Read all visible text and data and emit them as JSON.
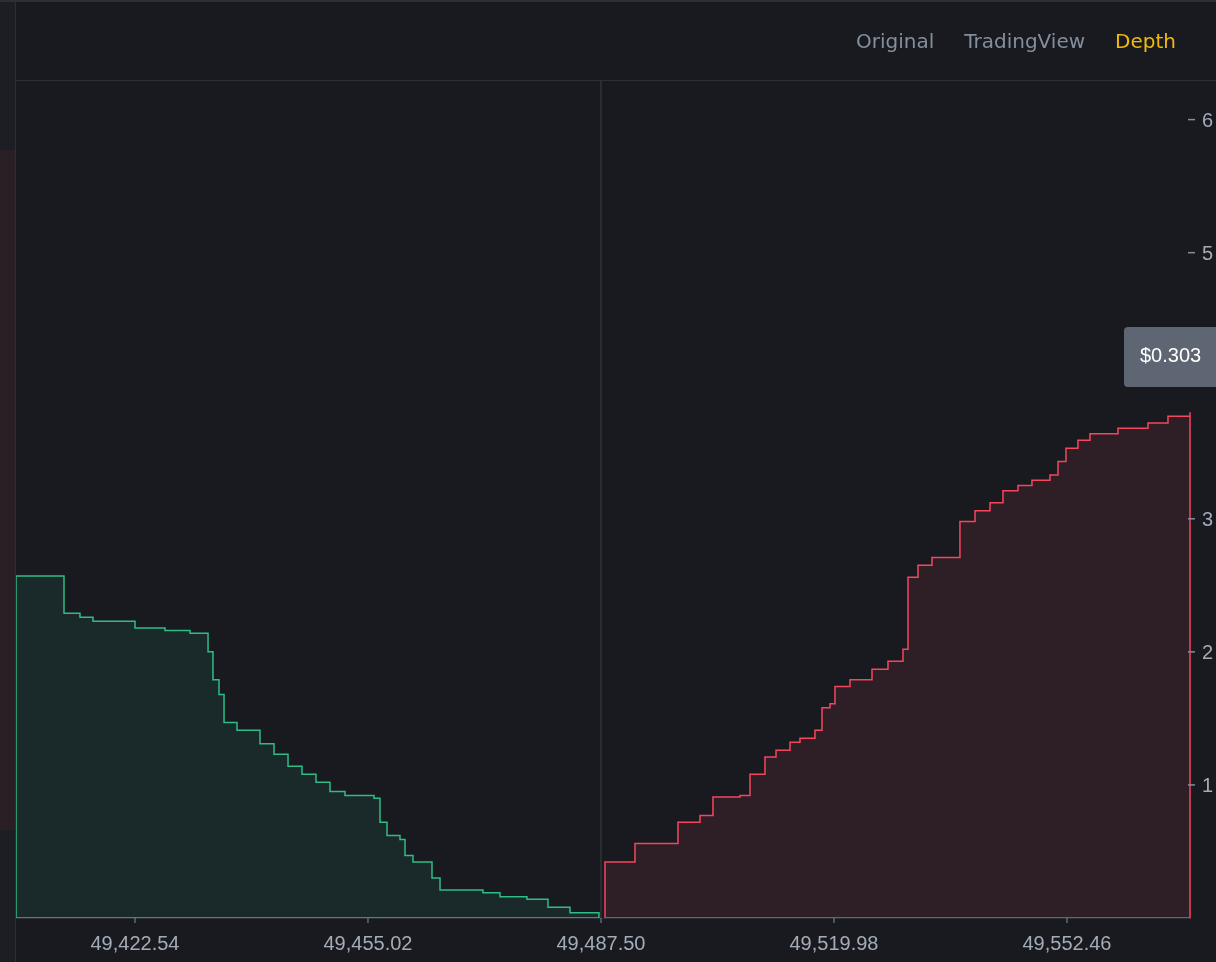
{
  "tabs": [
    {
      "label": "Original",
      "selected": false
    },
    {
      "label": "TradingView",
      "selected": false
    },
    {
      "label": "Depth",
      "selected": true
    }
  ],
  "tooltip": {
    "value": "$0.303"
  },
  "chart_data": {
    "type": "area",
    "x": [
      49405.95,
      49412.64,
      49414.87,
      49416.68,
      49422.54,
      49426.72,
      49430.21,
      49432.72,
      49433.41,
      49434.25,
      49434.95,
      49436.76,
      49439.96,
      49441.92,
      49443.87,
      49445.82,
      49447.77,
      49449.72,
      49451.81,
      49455.86,
      49456.69,
      49457.67,
      49459.48,
      49460.18,
      49461.29,
      49463.94,
      49465.06,
      49471.05,
      49473.42,
      49477.18,
      49480.11,
      49483.18,
      49487.22,
      49488.06,
      49492.24,
      49498.23,
      49501.3,
      49503.11,
      49506.88,
      49508.27,
      49510.36,
      49511.9,
      49513.85,
      49515.24,
      49517.33,
      49518.31,
      49519.42,
      49520.12,
      49522.21,
      49525.28,
      49527.51,
      49529.6,
      49530.3,
      49531.69,
      49533.64,
      49537.54,
      49539.64,
      49541.73,
      49543.54,
      49545.63,
      49547.58,
      49550.09,
      49551.21,
      49552.32,
      49553.99,
      49555.67,
      49559.57,
      49563.75,
      49566.54,
      49569.61
    ],
    "series": [
      {
        "color": "#2ebd85",
        "values": [
          2.57,
          2.29,
          2.26,
          2.23,
          2.18,
          2.16,
          2.14,
          2.0,
          1.79,
          1.68,
          1.47,
          1.41,
          1.31,
          1.23,
          1.14,
          1.08,
          1.02,
          0.95,
          0.92,
          0.9,
          0.72,
          0.62,
          0.59,
          0.47,
          0.42,
          0.3,
          0.21,
          0.19,
          0.16,
          0.14,
          0.08,
          0.04,
          0.01,
          null,
          null,
          null,
          null,
          null,
          null,
          null,
          null,
          null,
          null,
          null,
          null,
          null,
          null,
          null,
          null,
          null,
          null,
          null,
          null,
          null,
          null,
          null,
          null,
          null,
          null,
          null,
          null,
          null,
          null,
          null,
          null,
          null,
          null,
          null,
          null,
          null
        ]
      },
      {
        "color": "#f6465d",
        "values": [
          null,
          null,
          null,
          null,
          null,
          null,
          null,
          null,
          null,
          null,
          null,
          null,
          null,
          null,
          null,
          null,
          null,
          null,
          null,
          null,
          null,
          null,
          null,
          null,
          null,
          null,
          null,
          null,
          null,
          null,
          null,
          null,
          null,
          0.42,
          0.56,
          0.72,
          0.77,
          0.91,
          0.92,
          1.08,
          1.21,
          1.26,
          1.32,
          1.35,
          1.41,
          1.58,
          1.61,
          1.74,
          1.79,
          1.87,
          1.93,
          2.02,
          2.56,
          2.65,
          2.71,
          2.98,
          3.06,
          3.12,
          3.21,
          3.25,
          3.29,
          3.33,
          3.43,
          3.53,
          3.59,
          3.64,
          3.68,
          3.72,
          3.77,
          3.8
        ]
      }
    ],
    "xlim": [
      49405.95,
      49569.61
    ],
    "ylim": [
      0,
      6.29
    ],
    "xticks": [
      {
        "value": 49422.54,
        "label": "49,422.54"
      },
      {
        "value": 49455.02,
        "label": "49,455.02"
      },
      {
        "value": 49487.5,
        "label": "49,487.50"
      },
      {
        "value": 49519.98,
        "label": "49,519.98"
      },
      {
        "value": 49552.46,
        "label": "49,552.46"
      }
    ],
    "yticks": [
      1,
      2,
      3,
      5,
      6
    ]
  }
}
